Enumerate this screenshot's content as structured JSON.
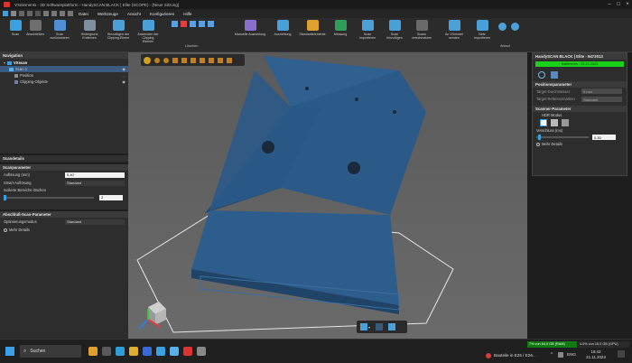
{
  "window": {
    "title": "VXelements - 3D Softwareplattform - HandySCAN BLACK | Elite (SCOPE) - [Neue Sitzung]"
  },
  "menu": [
    "Datei",
    "Werkzeuge",
    "Ansicht",
    "Konfigurieren",
    "Hilfe"
  ],
  "ribbon": {
    "buttons": [
      {
        "label": "Scan",
        "color": "#3aa0e0"
      },
      {
        "label": "Abschließen",
        "color": "#6f6f6f"
      },
      {
        "label": "Scan\nzurücksetzen",
        "color": "#4f8fd6"
      },
      {
        "label": "Hintergrund\nEntfernen",
        "color": "#7f8fa0"
      },
      {
        "label": "Hinzufügen der\nClipping-Ebene",
        "color": "#4aa0d8"
      },
      {
        "label": "Anwenden der\nClipping\nEbenen",
        "color": "#4aa0d8"
      },
      {
        "label": "Manuelle Ausrichtung",
        "color": "#8a6fd0"
      },
      {
        "label": "Ausrichtung",
        "color": "#4aa0d8"
      },
      {
        "label": "Standardelemente",
        "color": "#e0a030"
      },
      {
        "label": "Messung",
        "color": "#2e9e5a"
      },
      {
        "label": "Scan\nimportieren",
        "color": "#4aa0d8"
      },
      {
        "label": "Scan\nhinzufügen",
        "color": "#4aa0d8"
      },
      {
        "label": "Scans\nverschmelzen",
        "color": "#6a6a6a"
      },
      {
        "label": "An VXmodel\nsenden",
        "color": "#4aa0d8"
      },
      {
        "label": "Netz\nimportieren",
        "color": "#4aa0d8"
      }
    ],
    "groups": [
      "Löschen",
      "Ablauf"
    ]
  },
  "navigation": {
    "header": "Navigation",
    "root": "VXscan",
    "items": [
      "Scan 1",
      "Position",
      "Clipping-Objekte"
    ]
  },
  "scan_tab": "Scandetails",
  "scan_params": {
    "header": "Scanparameter",
    "resolution_label": "Auflösung (mm)",
    "resolution_value": "0,40",
    "smart_label": "Smart-Auflösung",
    "smart_value": "Standard",
    "holes_label": "Isolierte Bereiche löschen",
    "holes_value": "2"
  },
  "finish_params": {
    "header": "Abschluß-Scan-Parameter",
    "opt_label": "Optimierungsmodus",
    "opt_value": "Standard",
    "more": "Mehr Details"
  },
  "right_panel": {
    "device": "HandySCAN BLACK | Elite - 9472013",
    "status": "Kalibrieren - 21.11.2023",
    "pos_header": "Positionsparameter",
    "target_diameter_label": "Target-Durchmesser",
    "target_diameter_value": "6 mm",
    "target_ref_label": "Target Referenzmarken",
    "target_ref_value": "Standard",
    "scanner_header": "Scanner-Parameter",
    "hdr_label": "HDR Modus",
    "shutter_label": "Verschluss (ms)",
    "shutter_value": "0.30",
    "more": "Mehr Details"
  },
  "taskbar": {
    "search": "Suchen",
    "memory1": "7% von 64,0 GB (RAM)",
    "memory2": "4.0% von 16,0 GB (GPU)",
    "notification": "Bauteile in E25 / E26...",
    "lang": "ENG",
    "time": "18:43",
    "date": "21.11.2023"
  }
}
